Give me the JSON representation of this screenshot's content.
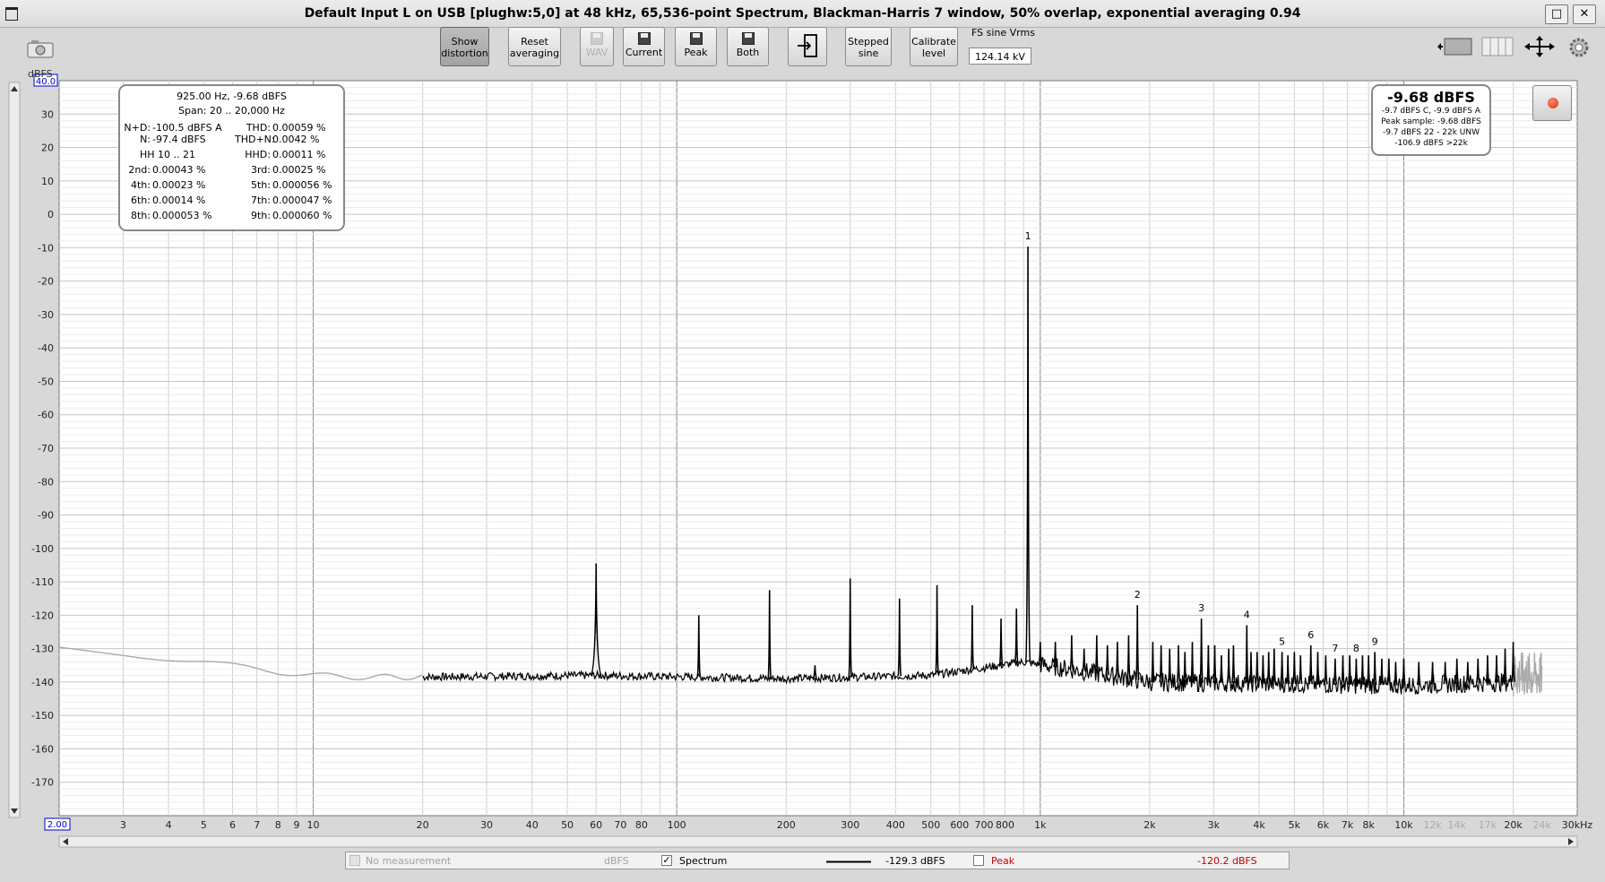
{
  "window": {
    "title": "Default Input L on USB [plughw:5,0] at 48 kHz, 65,536-point Spectrum, Blackman-Harris 7 window, 50% overlap, exponential averaging 0.94",
    "maximize_glyph": "□",
    "close_glyph": "✕"
  },
  "toolbar": {
    "show_distortion": [
      "Show",
      "distortion"
    ],
    "reset_averaging": [
      "Reset",
      "averaging"
    ],
    "wav": "WAV",
    "current": "Current",
    "peak": "Peak",
    "both": "Both",
    "stepped_sine": [
      "Stepped",
      "sine"
    ],
    "calibrate_level": [
      "Calibrate",
      "level"
    ],
    "fs_label": "FS sine Vrms",
    "fs_value": "124.14 kV"
  },
  "distortion_box": {
    "header1": "925.00 Hz, -9.68 dBFS",
    "header2": "Span: 20 .. 20,000 Hz",
    "rows": [
      [
        "N+D:",
        "-100.5 dBFS A",
        "THD:",
        "0.00059 %"
      ],
      [
        "N:",
        "-97.4 dBFS",
        "THD+N:",
        "0.0042 %"
      ],
      [
        "HH 10 .. 21",
        "",
        "HHD:",
        "0.00011 %"
      ],
      [
        "2nd:",
        "0.00043 %",
        "3rd:",
        "0.00025 %"
      ],
      [
        "4th:",
        "0.00023 %",
        "5th:",
        "0.000056 %"
      ],
      [
        "6th:",
        "0.00014 %",
        "7th:",
        "0.000047 %"
      ],
      [
        "8th:",
        "0.000053 %",
        "9th:",
        "0.000060 %"
      ]
    ]
  },
  "level_box": {
    "big": "-9.68 dBFS",
    "lines": [
      "-9.7 dBFS C, -9.9 dBFS A",
      "Peak sample: -9.68 dBFS",
      "-9.7 dBFS 22 - 22k UNW",
      "-106.9 dBFS >22k"
    ]
  },
  "legend": {
    "no_measurement": "No measurement",
    "unit": "dBFS",
    "spectrum": "Spectrum",
    "spectrum_value": "-129.3 dBFS",
    "peak": "Peak",
    "peak_value": "-120.2 dBFS",
    "checked_glyph": "✓"
  },
  "colors": {
    "trace": "#000000",
    "trace_grey": "#aaaaaa",
    "peak": "#cc0000",
    "axis_end_label": "#0000cc",
    "grid": "#d0d0d0"
  },
  "chart_data": {
    "type": "line",
    "xlabel": "Hz",
    "ylabel": "dBFS",
    "xscale": "log",
    "xlim": [
      2,
      30000
    ],
    "ylim": [
      -180,
      40
    ],
    "grid": true,
    "ytick_values": [
      30,
      20,
      10,
      0,
      -10,
      -20,
      -30,
      -40,
      -50,
      -60,
      -70,
      -80,
      -90,
      -100,
      -110,
      -120,
      -130,
      -140,
      -150,
      -160,
      -170
    ],
    "ytick_labels": [
      "30",
      "20",
      "10",
      "0",
      "-10",
      "-20",
      "-30",
      "-40",
      "-50",
      "-60",
      "-70",
      "-80",
      "-90",
      "-100",
      "-110",
      "-120",
      "-130",
      "-140",
      "-150",
      "-160",
      "-170"
    ],
    "ymax_label": "40.0",
    "xmin_label": "2.00",
    "xticks": [
      {
        "v": 3,
        "l": "3"
      },
      {
        "v": 4,
        "l": "4"
      },
      {
        "v": 5,
        "l": "5"
      },
      {
        "v": 6,
        "l": "6"
      },
      {
        "v": 7,
        "l": "7"
      },
      {
        "v": 8,
        "l": "8"
      },
      {
        "v": 9,
        "l": "9"
      },
      {
        "v": 10,
        "l": "10"
      },
      {
        "v": 20,
        "l": "20"
      },
      {
        "v": 30,
        "l": "30"
      },
      {
        "v": 40,
        "l": "40"
      },
      {
        "v": 50,
        "l": "50"
      },
      {
        "v": 60,
        "l": "60"
      },
      {
        "v": 70,
        "l": "70"
      },
      {
        "v": 80,
        "l": "80"
      },
      {
        "v": 100,
        "l": "100"
      },
      {
        "v": 200,
        "l": "200"
      },
      {
        "v": 300,
        "l": "300"
      },
      {
        "v": 400,
        "l": "400"
      },
      {
        "v": 500,
        "l": "500"
      },
      {
        "v": 600,
        "l": "600"
      },
      {
        "v": 700,
        "l": "700"
      },
      {
        "v": 800,
        "l": "800"
      },
      {
        "v": 1000,
        "l": "1k"
      },
      {
        "v": 2000,
        "l": "2k"
      },
      {
        "v": 3000,
        "l": "3k"
      },
      {
        "v": 4000,
        "l": "4k"
      },
      {
        "v": 5000,
        "l": "5k"
      },
      {
        "v": 6000,
        "l": "6k"
      },
      {
        "v": 7000,
        "l": "7k"
      },
      {
        "v": 8000,
        "l": "8k"
      },
      {
        "v": 10000,
        "l": "10k"
      },
      {
        "v": 12000,
        "l": "12k",
        "grey": true
      },
      {
        "v": 14000,
        "l": "14k",
        "grey": true
      },
      {
        "v": 17000,
        "l": "17k",
        "grey": true
      },
      {
        "v": 20000,
        "l": "20k"
      },
      {
        "v": 24000,
        "l": "24k",
        "grey": true
      },
      {
        "v": 30000,
        "l": "30kHz"
      }
    ],
    "noise_floor": [
      [
        2,
        -130
      ],
      [
        3,
        -131.5
      ],
      [
        5,
        -134
      ],
      [
        8,
        -137
      ],
      [
        12,
        -138.5
      ],
      [
        20,
        -138.5
      ],
      [
        60,
        -138
      ],
      [
        200,
        -139
      ],
      [
        500,
        -138
      ],
      [
        900,
        -134
      ],
      [
        2000,
        -140
      ],
      [
        10000,
        -141
      ],
      [
        20000,
        -140
      ]
    ],
    "spectrum_spikes": [
      [
        60,
        -104.5
      ],
      [
        115,
        -120
      ],
      [
        180,
        -112.5
      ],
      [
        240,
        -135
      ],
      [
        300,
        -109
      ],
      [
        410,
        -115
      ],
      [
        520,
        -111
      ],
      [
        650,
        -117
      ],
      [
        780,
        -121
      ],
      [
        860,
        -118
      ],
      [
        925,
        -9.68
      ],
      [
        1000,
        -128
      ],
      [
        1100,
        -128
      ],
      [
        1220,
        -126
      ],
      [
        1320,
        -130
      ],
      [
        1430,
        -126
      ],
      [
        1530,
        -129
      ],
      [
        1630,
        -128
      ],
      [
        1750,
        -126
      ],
      [
        1850,
        -117
      ],
      [
        2040,
        -128
      ],
      [
        2150,
        -129
      ],
      [
        2270,
        -130
      ],
      [
        2400,
        -129
      ],
      [
        2500,
        -131
      ],
      [
        2620,
        -128
      ],
      [
        2775,
        -121
      ],
      [
        2900,
        -129
      ],
      [
        3020,
        -129
      ],
      [
        3150,
        -132
      ],
      [
        3300,
        -130
      ],
      [
        3400,
        -129
      ],
      [
        3700,
        -123
      ],
      [
        3800,
        -131
      ],
      [
        3950,
        -131
      ],
      [
        4100,
        -132
      ],
      [
        4250,
        -131
      ],
      [
        4400,
        -130
      ],
      [
        4625,
        -131
      ],
      [
        4800,
        -132
      ],
      [
        5000,
        -131
      ],
      [
        5200,
        -132
      ],
      [
        5550,
        -129
      ],
      [
        5800,
        -131
      ],
      [
        6100,
        -132
      ],
      [
        6475,
        -133
      ],
      [
        6800,
        -132
      ],
      [
        7100,
        -132
      ],
      [
        7400,
        -133
      ],
      [
        7700,
        -132
      ],
      [
        8000,
        -132
      ],
      [
        8325,
        -131
      ],
      [
        8700,
        -133
      ],
      [
        9100,
        -133
      ],
      [
        9500,
        -134
      ],
      [
        10000,
        -133
      ],
      [
        11000,
        -134
      ],
      [
        12000,
        -134
      ],
      [
        13000,
        -134
      ],
      [
        14000,
        -133
      ],
      [
        15000,
        -134
      ],
      [
        16000,
        -133
      ],
      [
        17000,
        -132
      ],
      [
        18000,
        -132
      ],
      [
        19000,
        -130
      ],
      [
        20000,
        -128
      ]
    ],
    "harmonic_labels": [
      {
        "n": "1",
        "f": 925,
        "db": -9.68
      },
      {
        "n": "2",
        "f": 1850,
        "db": -117
      },
      {
        "n": "3",
        "f": 2775,
        "db": -121
      },
      {
        "n": "4",
        "f": 3700,
        "db": -123
      },
      {
        "n": "5",
        "f": 4625,
        "db": -131
      },
      {
        "n": "6",
        "f": 5550,
        "db": -129
      },
      {
        "n": "7",
        "f": 6475,
        "db": -133
      },
      {
        "n": "8",
        "f": 7400,
        "db": -133
      },
      {
        "n": "9",
        "f": 8325,
        "db": -131
      }
    ]
  }
}
